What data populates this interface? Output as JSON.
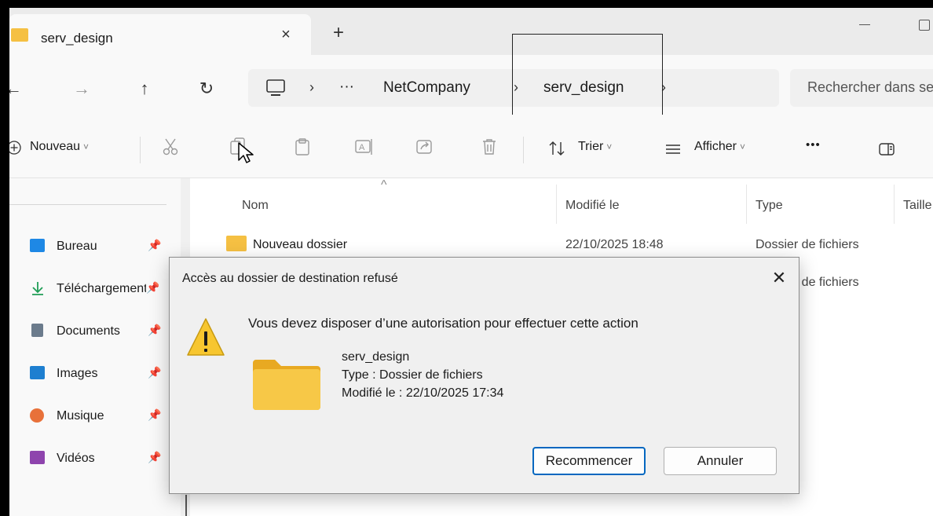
{
  "tab": {
    "title": "serv_design",
    "close_glyph": "×",
    "new_tab_glyph": "+"
  },
  "nav": {
    "back_glyph": "←",
    "forward_glyph": "→",
    "up_glyph": "↑",
    "refresh_glyph": "↻",
    "sep_glyph": "›",
    "ellipsis_glyph": "···",
    "crumbs": [
      "NetCompany",
      "serv_design"
    ],
    "search_placeholder": "Rechercher dans serv_design"
  },
  "toolbar": {
    "new_label": "Nouveau",
    "sort_label": "Trier",
    "view_label": "Afficher",
    "more_glyph": "•••",
    "chevron_glyph": "˅"
  },
  "sidebar": {
    "items": [
      {
        "label": "Bureau",
        "icon": "desktop-icon",
        "color": "#1e88e5"
      },
      {
        "label": "Téléchargements",
        "icon": "download-icon",
        "color": "#1f9d55"
      },
      {
        "label": "Documents",
        "icon": "documents-icon",
        "color": "#6b7b8c"
      },
      {
        "label": "Images",
        "icon": "images-icon",
        "color": "#1e7fd0"
      },
      {
        "label": "Musique",
        "icon": "music-icon",
        "color": "#e8713a"
      },
      {
        "label": "Vidéos",
        "icon": "videos-icon",
        "color": "#8e44ad"
      }
    ],
    "pin_glyph": "📌"
  },
  "filelist": {
    "columns": [
      "Nom",
      "Modifié le",
      "Type",
      "Taille"
    ],
    "rows": [
      {
        "name": "Nouveau dossier",
        "modified": "22/10/2025 18:48",
        "type": "Dossier de fichiers"
      },
      {
        "name": "",
        "modified": "",
        "type": "Dossier de fichiers"
      }
    ]
  },
  "dialog": {
    "title": "Accès au dossier de destination refusé",
    "close_glyph": "✕",
    "message": "Vous devez disposer d’une autorisation pour effectuer cette action",
    "item_name": "serv_design",
    "item_type": "Type : Dossier de fichiers",
    "item_modified": "Modifié le : 22/10/2025 17:34",
    "retry_label": "Recommencer",
    "cancel_label": "Annuler"
  },
  "colors": {
    "accent": "#0067c0",
    "folder": "#f5c043",
    "warning": "#f7c62f"
  }
}
